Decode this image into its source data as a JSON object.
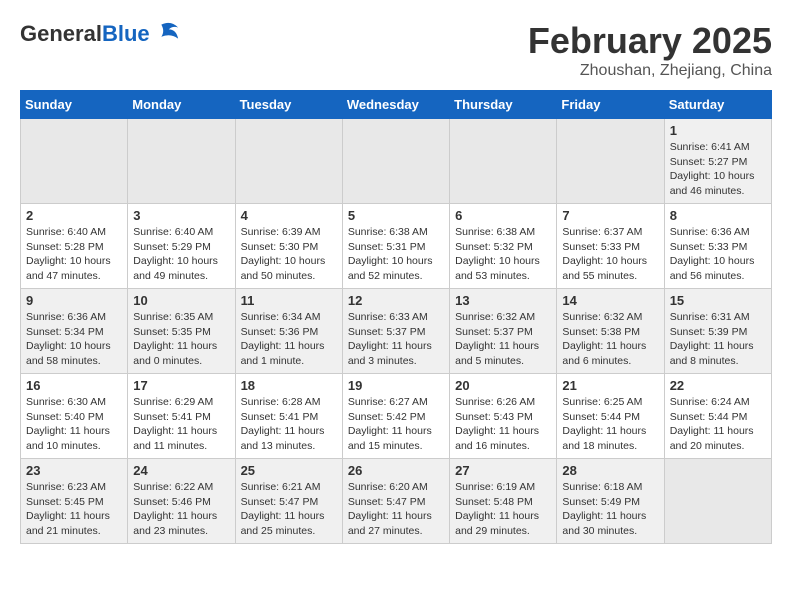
{
  "logo": {
    "general": "General",
    "blue": "Blue"
  },
  "header": {
    "month_year": "February 2025",
    "location": "Zhoushan, Zhejiang, China"
  },
  "weekdays": [
    "Sunday",
    "Monday",
    "Tuesday",
    "Wednesday",
    "Thursday",
    "Friday",
    "Saturday"
  ],
  "weeks": [
    [
      {
        "day": "",
        "info": ""
      },
      {
        "day": "",
        "info": ""
      },
      {
        "day": "",
        "info": ""
      },
      {
        "day": "",
        "info": ""
      },
      {
        "day": "",
        "info": ""
      },
      {
        "day": "",
        "info": ""
      },
      {
        "day": "1",
        "info": "Sunrise: 6:41 AM\nSunset: 5:27 PM\nDaylight: 10 hours and 46 minutes."
      }
    ],
    [
      {
        "day": "2",
        "info": "Sunrise: 6:40 AM\nSunset: 5:28 PM\nDaylight: 10 hours and 47 minutes."
      },
      {
        "day": "3",
        "info": "Sunrise: 6:40 AM\nSunset: 5:29 PM\nDaylight: 10 hours and 49 minutes."
      },
      {
        "day": "4",
        "info": "Sunrise: 6:39 AM\nSunset: 5:30 PM\nDaylight: 10 hours and 50 minutes."
      },
      {
        "day": "5",
        "info": "Sunrise: 6:38 AM\nSunset: 5:31 PM\nDaylight: 10 hours and 52 minutes."
      },
      {
        "day": "6",
        "info": "Sunrise: 6:38 AM\nSunset: 5:32 PM\nDaylight: 10 hours and 53 minutes."
      },
      {
        "day": "7",
        "info": "Sunrise: 6:37 AM\nSunset: 5:33 PM\nDaylight: 10 hours and 55 minutes."
      },
      {
        "day": "8",
        "info": "Sunrise: 6:36 AM\nSunset: 5:33 PM\nDaylight: 10 hours and 56 minutes."
      }
    ],
    [
      {
        "day": "9",
        "info": "Sunrise: 6:36 AM\nSunset: 5:34 PM\nDaylight: 10 hours and 58 minutes."
      },
      {
        "day": "10",
        "info": "Sunrise: 6:35 AM\nSunset: 5:35 PM\nDaylight: 11 hours and 0 minutes."
      },
      {
        "day": "11",
        "info": "Sunrise: 6:34 AM\nSunset: 5:36 PM\nDaylight: 11 hours and 1 minute."
      },
      {
        "day": "12",
        "info": "Sunrise: 6:33 AM\nSunset: 5:37 PM\nDaylight: 11 hours and 3 minutes."
      },
      {
        "day": "13",
        "info": "Sunrise: 6:32 AM\nSunset: 5:37 PM\nDaylight: 11 hours and 5 minutes."
      },
      {
        "day": "14",
        "info": "Sunrise: 6:32 AM\nSunset: 5:38 PM\nDaylight: 11 hours and 6 minutes."
      },
      {
        "day": "15",
        "info": "Sunrise: 6:31 AM\nSunset: 5:39 PM\nDaylight: 11 hours and 8 minutes."
      }
    ],
    [
      {
        "day": "16",
        "info": "Sunrise: 6:30 AM\nSunset: 5:40 PM\nDaylight: 11 hours and 10 minutes."
      },
      {
        "day": "17",
        "info": "Sunrise: 6:29 AM\nSunset: 5:41 PM\nDaylight: 11 hours and 11 minutes."
      },
      {
        "day": "18",
        "info": "Sunrise: 6:28 AM\nSunset: 5:41 PM\nDaylight: 11 hours and 13 minutes."
      },
      {
        "day": "19",
        "info": "Sunrise: 6:27 AM\nSunset: 5:42 PM\nDaylight: 11 hours and 15 minutes."
      },
      {
        "day": "20",
        "info": "Sunrise: 6:26 AM\nSunset: 5:43 PM\nDaylight: 11 hours and 16 minutes."
      },
      {
        "day": "21",
        "info": "Sunrise: 6:25 AM\nSunset: 5:44 PM\nDaylight: 11 hours and 18 minutes."
      },
      {
        "day": "22",
        "info": "Sunrise: 6:24 AM\nSunset: 5:44 PM\nDaylight: 11 hours and 20 minutes."
      }
    ],
    [
      {
        "day": "23",
        "info": "Sunrise: 6:23 AM\nSunset: 5:45 PM\nDaylight: 11 hours and 21 minutes."
      },
      {
        "day": "24",
        "info": "Sunrise: 6:22 AM\nSunset: 5:46 PM\nDaylight: 11 hours and 23 minutes."
      },
      {
        "day": "25",
        "info": "Sunrise: 6:21 AM\nSunset: 5:47 PM\nDaylight: 11 hours and 25 minutes."
      },
      {
        "day": "26",
        "info": "Sunrise: 6:20 AM\nSunset: 5:47 PM\nDaylight: 11 hours and 27 minutes."
      },
      {
        "day": "27",
        "info": "Sunrise: 6:19 AM\nSunset: 5:48 PM\nDaylight: 11 hours and 29 minutes."
      },
      {
        "day": "28",
        "info": "Sunrise: 6:18 AM\nSunset: 5:49 PM\nDaylight: 11 hours and 30 minutes."
      },
      {
        "day": "",
        "info": ""
      }
    ]
  ]
}
